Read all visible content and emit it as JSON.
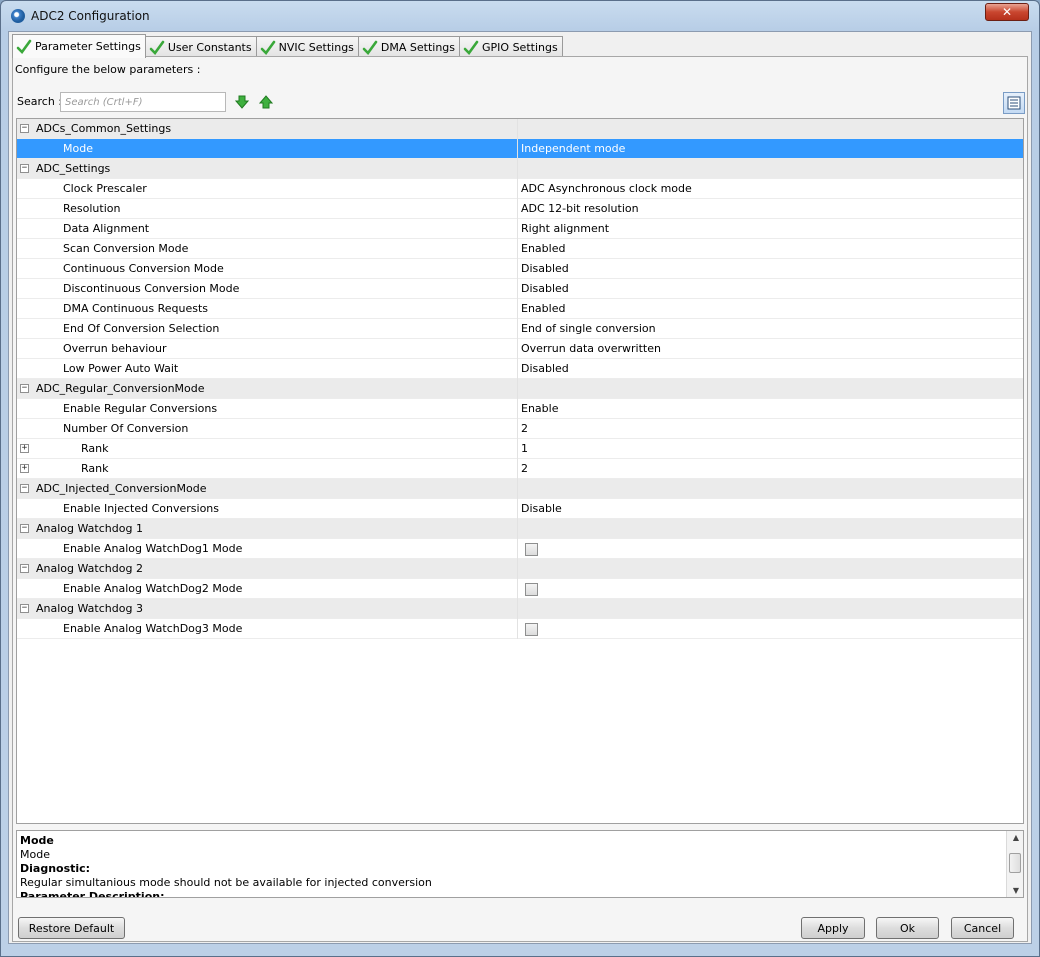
{
  "window": {
    "title": "ADC2 Configuration",
    "close_label": "✕"
  },
  "tabs": [
    {
      "label": "Parameter Settings"
    },
    {
      "label": "User Constants"
    },
    {
      "label": "NVIC Settings"
    },
    {
      "label": "DMA Settings"
    },
    {
      "label": "GPIO Settings"
    }
  ],
  "hint": "Configure the below parameters :",
  "search": {
    "label": "Search :",
    "placeholder": "Search (Crtl+F)"
  },
  "rows": [
    {
      "name": "ADCs_Common_Settings",
      "value": "",
      "toggle": "−"
    },
    {
      "name": "Mode",
      "value": "Independent mode"
    },
    {
      "name": "ADC_Settings",
      "value": "",
      "toggle": "−"
    },
    {
      "name": "Clock Prescaler",
      "value": "ADC Asynchronous clock mode"
    },
    {
      "name": "Resolution",
      "value": "ADC 12-bit resolution"
    },
    {
      "name": "Data Alignment",
      "value": "Right alignment"
    },
    {
      "name": "Scan Conversion Mode",
      "value": "Enabled"
    },
    {
      "name": "Continuous Conversion Mode",
      "value": "Disabled"
    },
    {
      "name": "Discontinuous Conversion Mode",
      "value": "Disabled"
    },
    {
      "name": "DMA Continuous Requests",
      "value": "Enabled"
    },
    {
      "name": "End Of Conversion Selection",
      "value": "End of single conversion"
    },
    {
      "name": "Overrun behaviour",
      "value": "Overrun data overwritten"
    },
    {
      "name": "Low Power Auto Wait",
      "value": "Disabled"
    },
    {
      "name": "ADC_Regular_ConversionMode",
      "value": "",
      "toggle": "−"
    },
    {
      "name": "Enable Regular Conversions",
      "value": "Enable"
    },
    {
      "name": "Number Of Conversion",
      "value": "2"
    },
    {
      "name": "Rank",
      "value": "1",
      "toggle": "+"
    },
    {
      "name": "Rank",
      "value": "2",
      "toggle": "+"
    },
    {
      "name": "ADC_Injected_ConversionMode",
      "value": "",
      "toggle": "−"
    },
    {
      "name": "Enable Injected Conversions",
      "value": "Disable"
    },
    {
      "name": "Analog Watchdog 1",
      "value": "",
      "toggle": "−"
    },
    {
      "name": "Enable Analog WatchDog1 Mode",
      "value": "",
      "checkbox": false
    },
    {
      "name": "Analog Watchdog 2",
      "value": "",
      "toggle": "−"
    },
    {
      "name": "Enable Analog WatchDog2 Mode",
      "value": "",
      "checkbox": false
    },
    {
      "name": "Analog Watchdog 3",
      "value": "",
      "toggle": "−"
    },
    {
      "name": "Enable Analog WatchDog3 Mode",
      "value": "",
      "checkbox": false
    }
  ],
  "description": {
    "title": "Mode",
    "subtitle": "Mode",
    "diagnostic_label": "Diagnostic:",
    "diagnostic_text": "Regular simultanious mode should not be available for injected conversion",
    "param_desc_label": "Parameter Description:"
  },
  "buttons": {
    "restore": "Restore Default",
    "apply": "Apply",
    "ok": "Ok",
    "cancel": "Cancel"
  },
  "colors": {
    "selection": "#3399ff",
    "check": "#3aa83a"
  }
}
